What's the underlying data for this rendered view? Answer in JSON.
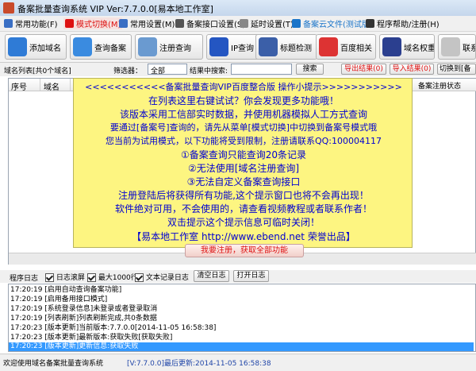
{
  "window": {
    "title": "备案批量查询系统 VIP Ver:7.7.0.0[易本地工作室]"
  },
  "menu": [
    {
      "label": "常用功能(F)",
      "color": "#3a6fc4"
    },
    {
      "label": "模式切换(M)",
      "color": "#d11",
      "highlight": true
    },
    {
      "label": "常用设置(M)",
      "color": "#3a6fc4"
    },
    {
      "label": "备案接口设置(S)",
      "color": "#555"
    },
    {
      "label": "延时设置(T)",
      "color": "#888"
    },
    {
      "label": "备案云文件(测试版)",
      "color": "#1b75c9",
      "accent": true
    },
    {
      "label": "程序帮助/注册(H)",
      "color": "#333"
    }
  ],
  "toolbar": [
    {
      "label": "添加域名",
      "icon": "add-domain-icon",
      "color": "#2f7bd6"
    },
    {
      "label": "查询备案",
      "icon": "query-icon",
      "color": "#3a8be0"
    },
    {
      "label": "注册查询",
      "icon": "register-icon",
      "color": "#6a9ad0"
    },
    {
      "label": "IP查询",
      "icon": "ip-icon",
      "color": "#2456c2"
    },
    {
      "label": "标题检测",
      "icon": "title-check-icon",
      "color": "#3b5fa8"
    },
    {
      "label": "百度相关",
      "icon": "baidu-icon",
      "color": "#d33"
    },
    {
      "label": "域名权重",
      "icon": "weight-icon",
      "color": "#2b3f8f"
    },
    {
      "label": "联系",
      "icon": "contact-icon",
      "color": "#c4c4c4"
    }
  ],
  "filter": {
    "list_label": "域名列表[共0个域名]",
    "filter_label": "筛选器：",
    "filter_value": "全部",
    "search_label": "结果中搜索:",
    "search_placeholder": "",
    "search_button": "搜索",
    "export": "导出结果(0)",
    "import": "导入结果(0)",
    "switch": "切换到[备"
  },
  "table": {
    "columns": [
      "序号",
      "域名",
      "备案注册状态"
    ]
  },
  "popup": {
    "lines": [
      "<<<<<<<<<<<备案批量查询VIP百度整合版 操作小提示>>>>>>>>>>>",
      "在列表这里右键试试？你会发现更多功能哦！",
      "该版本采用工信部实时数据，并使用机器模拟人工方式查询",
      "要通过[备案号]查询的，请先从菜单[模式切换]中切换到备案号模式哦",
      "您当前为试用模式，以下功能将受到限制，注册请联系QQ:100004117",
      "①备案查询只能查询20条记录",
      "②无法使用[域名注册查询]",
      "③无法自定义备案查询接口",
      "注册登陆后将获得所有功能,这个提示窗口也将不会再出现！",
      "软件绝对可用，不会使用的，请查看视频教程或者联系作者！",
      "双击提示这个提示信息可临时关闭！",
      "【易本地工作室 http://www.ebend.net 荣誉出品】"
    ],
    "register_button": "我要注册，获取全部功能"
  },
  "log": {
    "label": "程序日志",
    "check1": "日志滚屏",
    "check2": "最大1000行",
    "check3": "文本记录日志",
    "clear": "清空日志",
    "open": "打开日志",
    "entries": [
      {
        "text": "17:20:19  [启用自动查询备案功能]",
        "selected": false
      },
      {
        "text": "17:20:19  [启用备用接口模式]",
        "selected": false
      },
      {
        "text": "17:20:19  [系统登录信息]未登录或者登录取消",
        "selected": false
      },
      {
        "text": "17:20:19  [列表刷新]列表刷新完成,共0条数据",
        "selected": false
      },
      {
        "text": "17:20:23  [版本更新]当前版本:7.7.0.0[2014-11-05 16:58:38]",
        "selected": false
      },
      {
        "text": "17:20:23  [版本更新]最新版本:获取失败[获取失败]",
        "selected": false
      },
      {
        "text": "17:20:23  [版本更新]更新信息:获取失败",
        "selected": true
      }
    ]
  },
  "status": {
    "text": "欢迎使用域名备案批量查询系统",
    "version": "[V:7.7.0.0]最后更新:2014-11-05 16:58:38"
  }
}
